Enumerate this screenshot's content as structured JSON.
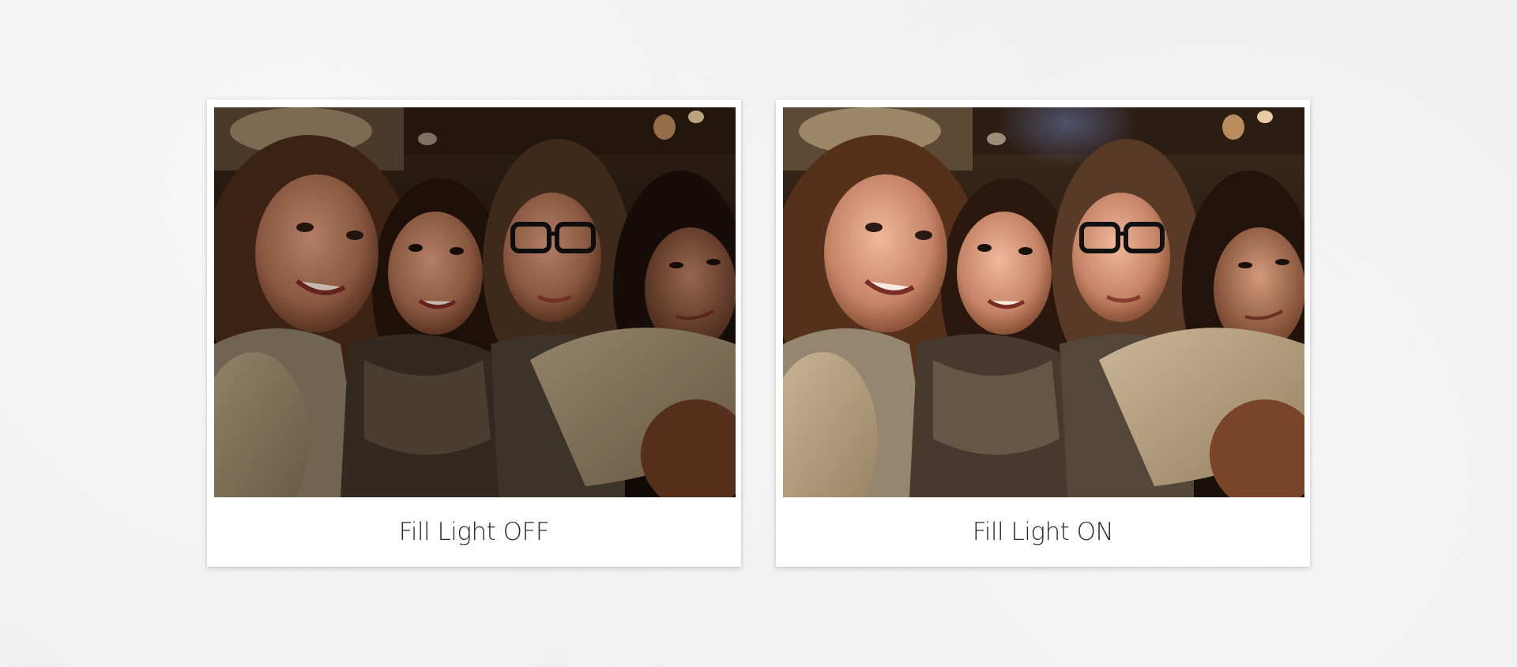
{
  "panels": [
    {
      "caption": "Fill Light OFF",
      "fill_light": false
    },
    {
      "caption": "Fill Light ON",
      "fill_light": true
    }
  ],
  "colors": {
    "background": "#efefef",
    "frame": "#ffffff",
    "caption_text": "#2a2a2a"
  }
}
